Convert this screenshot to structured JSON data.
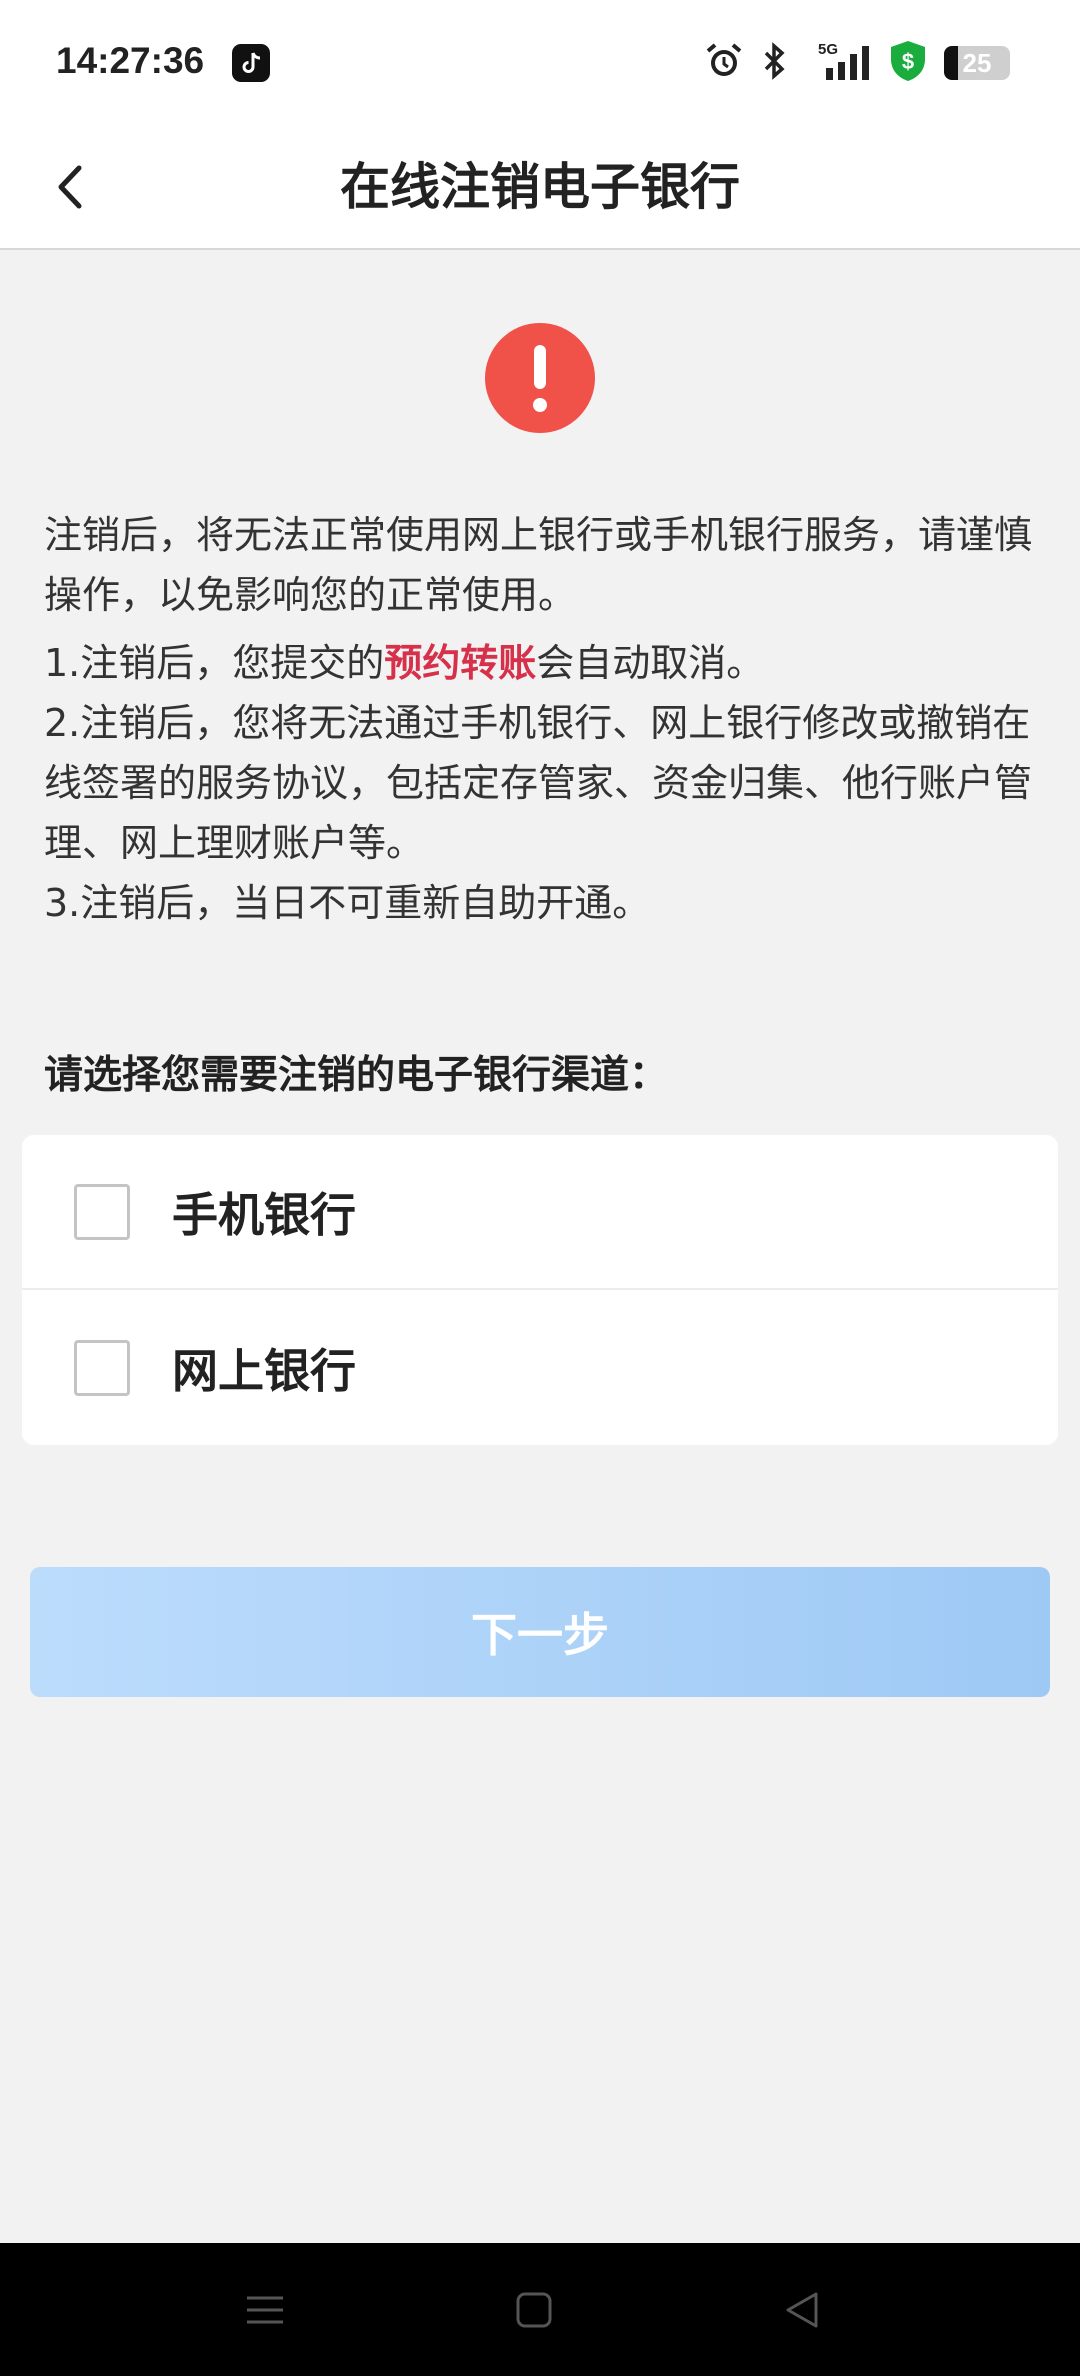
{
  "status_bar": {
    "time": "14:27:36",
    "network": "5G",
    "battery": "25",
    "icons": [
      "tiktok-icon",
      "alarm-icon",
      "bluetooth-icon",
      "signal-icon",
      "security-shield-icon",
      "battery-icon"
    ]
  },
  "header": {
    "title": "在线注销电子银行",
    "back_icon": "chevron-left-icon"
  },
  "warning": {
    "icon": "exclamation-icon",
    "intro": "注销后，将无法正常使用网上银行或手机银行服务，请谨慎操作，以免影响您的正常使用。",
    "item1_prefix": "1.注销后，您提交的",
    "item1_highlight": "预约转账",
    "item1_suffix": "会自动取消。",
    "item2": "2.注销后，您将无法通过手机银行、网上银行修改或撤销在线签署的服务协议，包括定存管家、资金归集、他行账户管理、网上理财账户等。",
    "item3": "3.注销后，当日不可重新自助开通。"
  },
  "selection": {
    "label": "请选择您需要注销的电子银行渠道：",
    "options": [
      {
        "label": "手机银行",
        "checked": false
      },
      {
        "label": "网上银行",
        "checked": false
      }
    ]
  },
  "next_button": {
    "label": "下一步",
    "enabled": false
  },
  "colors": {
    "accent_red": "#f0524a",
    "highlight": "#d6304a",
    "button_disabled": "#aed2f8",
    "background": "#f2f2f2"
  }
}
